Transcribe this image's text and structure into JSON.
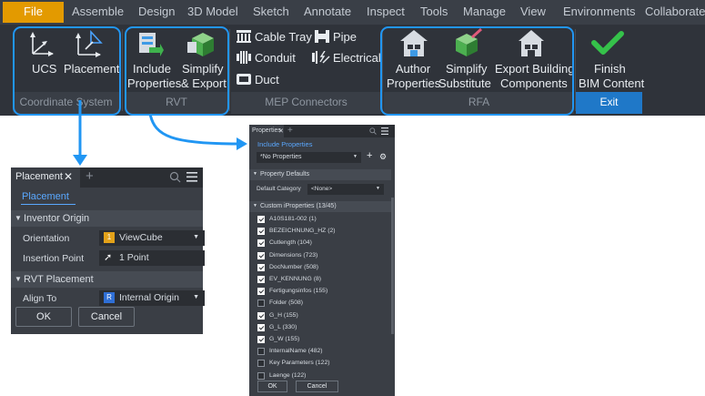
{
  "ribbon": {
    "menu": [
      "File",
      "Assemble",
      "Design",
      "3D Model",
      "Sketch",
      "Annotate",
      "Inspect",
      "Tools",
      "Manage",
      "View",
      "Environments",
      "Collaborate"
    ],
    "coordinate_system": {
      "group_label": "Coordinate System",
      "ucs": "UCS",
      "placement": "Placement"
    },
    "rvt": {
      "group_label": "RVT",
      "include_l1": "Include",
      "include_l2": "Properties",
      "simplify_l1": "Simplify",
      "simplify_l2": "& Export"
    },
    "mep": {
      "group_label": "MEP Connectors",
      "cable_tray": "Cable Tray",
      "pipe": "Pipe",
      "conduit": "Conduit",
      "electrical": "Electrical",
      "duct": "Duct"
    },
    "rfa": {
      "group_label": "RFA",
      "author_l1": "Author",
      "author_l2": "Properties",
      "simplify_l1": "Simplify",
      "simplify_l2": "Substitute",
      "export_l1": "Export Building",
      "export_l2": "Components"
    },
    "exit": {
      "group_label": "Exit",
      "finish_l1": "Finish",
      "finish_l2": "BIM Content"
    }
  },
  "placement_panel": {
    "tab": "Placement",
    "link": "Placement",
    "inventor_origin": "Inventor Origin",
    "orientation_label": "Orientation",
    "orientation_value": "ViewCube",
    "insertion_label": "Insertion Point",
    "insertion_value": "1 Point",
    "rvt_placement": "RVT Placement",
    "align_label": "Align To",
    "align_value": "Internal Origin",
    "ok": "OK",
    "cancel": "Cancel"
  },
  "properties_panel": {
    "tab": "Properties",
    "link": "Include Properties",
    "select_value": "*No Properties",
    "property_defaults": "Property Defaults",
    "default_category_label": "Default Category",
    "default_category_value": "<None>",
    "custom_header": "Custom iProperties (13/45)",
    "items": [
      {
        "label": "A10S181-002 (1)",
        "checked": true
      },
      {
        "label": "BEZEICHNUNG_HZ (2)",
        "checked": true
      },
      {
        "label": "Cutlength (104)",
        "checked": true
      },
      {
        "label": "Dimensions (723)",
        "checked": true
      },
      {
        "label": "DocNumber (508)",
        "checked": true
      },
      {
        "label": "EV_KENNUNG (8)",
        "checked": true
      },
      {
        "label": "Fertigungsinfos (155)",
        "checked": true
      },
      {
        "label": "Folder (508)",
        "checked": false
      },
      {
        "label": "G_H (155)",
        "checked": true
      },
      {
        "label": "G_L (330)",
        "checked": true
      },
      {
        "label": "G_W (155)",
        "checked": true
      },
      {
        "label": "InternalName (482)",
        "checked": false
      },
      {
        "label": "Key Parameters (122)",
        "checked": false
      },
      {
        "label": "Laenge (122)",
        "checked": false
      }
    ],
    "ok": "OK",
    "cancel": "Cancel"
  },
  "colors": {
    "ribbon_bg": "#2f333a",
    "file_tab": "#e39a00",
    "callout_blue": "#2196f3",
    "exit_blue": "#1f78c8",
    "link_blue": "#5aa8ff",
    "check_green": "#35c24a"
  },
  "icons": [
    "ucs-icon",
    "placement-icon",
    "include-properties-icon",
    "simplify-export-icon",
    "cable-tray-icon",
    "pipe-icon",
    "conduit-icon",
    "electrical-icon",
    "duct-icon",
    "author-properties-icon",
    "simplify-substitute-icon",
    "export-building-components-icon",
    "finish-checkmark-icon",
    "search-icon",
    "menu-icon",
    "settings-gear-icon"
  ]
}
